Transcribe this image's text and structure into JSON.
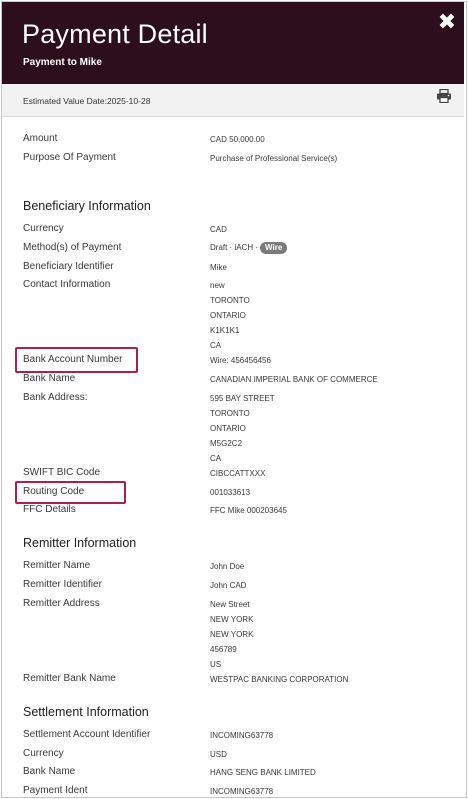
{
  "header": {
    "title": "Payment Detail",
    "subtitle": "Payment to Mike",
    "close_icon": "close-icon",
    "bg_color": "#2d0e1c"
  },
  "subbar": {
    "estimated_value_date": "Estimated Value Date:2025-10-28",
    "print_icon": "print-icon"
  },
  "summary": {
    "amount_label": "Amount",
    "amount_value": "CAD 50,000.00",
    "purpose_label": "Purpose Of Payment",
    "purpose_value": "Purchase of Professional Service(s)"
  },
  "beneficiary": {
    "heading": "Beneficiary Information",
    "currency_label": "Currency",
    "currency_value": "CAD",
    "method_label": "Method(s) of Payment",
    "method_value": "Draft · iACH ·",
    "method_badge": "Wire",
    "identifier_label": "Beneficiary Identifier",
    "identifier_value": "Mike",
    "contact_label": "Contact Information",
    "contact_lines": [
      "new",
      "TORONTO",
      "ONTARIO",
      "K1K1K1",
      "CA"
    ],
    "account_label": "Bank Account Number",
    "account_value": "Wire: 456456456",
    "bank_name_label": "Bank Name",
    "bank_name_value": "CANADIAN IMPERIAL BANK OF COMMERCE",
    "bank_address_label": "Bank Address:",
    "bank_address_lines": [
      "595 BAY STREET",
      "TORONTO",
      "ONTARIO",
      "M5G2C2",
      "CA"
    ],
    "swift_label": "SWIFT BIC Code",
    "swift_value": "CIBCCATTXXX",
    "routing_label": "Routing Code",
    "routing_value": "001033613",
    "ffc_label": "FFC Details",
    "ffc_value": "FFC Mike 000203645"
  },
  "remitter": {
    "heading": "Remitter Information",
    "name_label": "Remitter Name",
    "name_value": "John Doe",
    "identifier_label": "Remitter Identifier",
    "identifier_value": "John CAD",
    "address_label": "Remitter Address",
    "address_lines": [
      "New Street",
      "NEW YORK",
      "NEW YORK",
      "456789",
      "US"
    ],
    "bank_name_label": "Remitter Bank Name",
    "bank_name_value": "WESTPAC BANKING CORPORATION"
  },
  "settlement": {
    "heading": "Settlement Information",
    "account_label": "Settlement Account Identifier",
    "account_value": "INCOMING63778",
    "currency_label": "Currency",
    "currency_value": "USD",
    "bank_name_label": "Bank Name",
    "bank_name_value": "HANG SENG BANK LIMITED",
    "ident_label": "Payment Ident",
    "ident_value": "INCOMING63778"
  },
  "highlight_color": "#a8234b"
}
